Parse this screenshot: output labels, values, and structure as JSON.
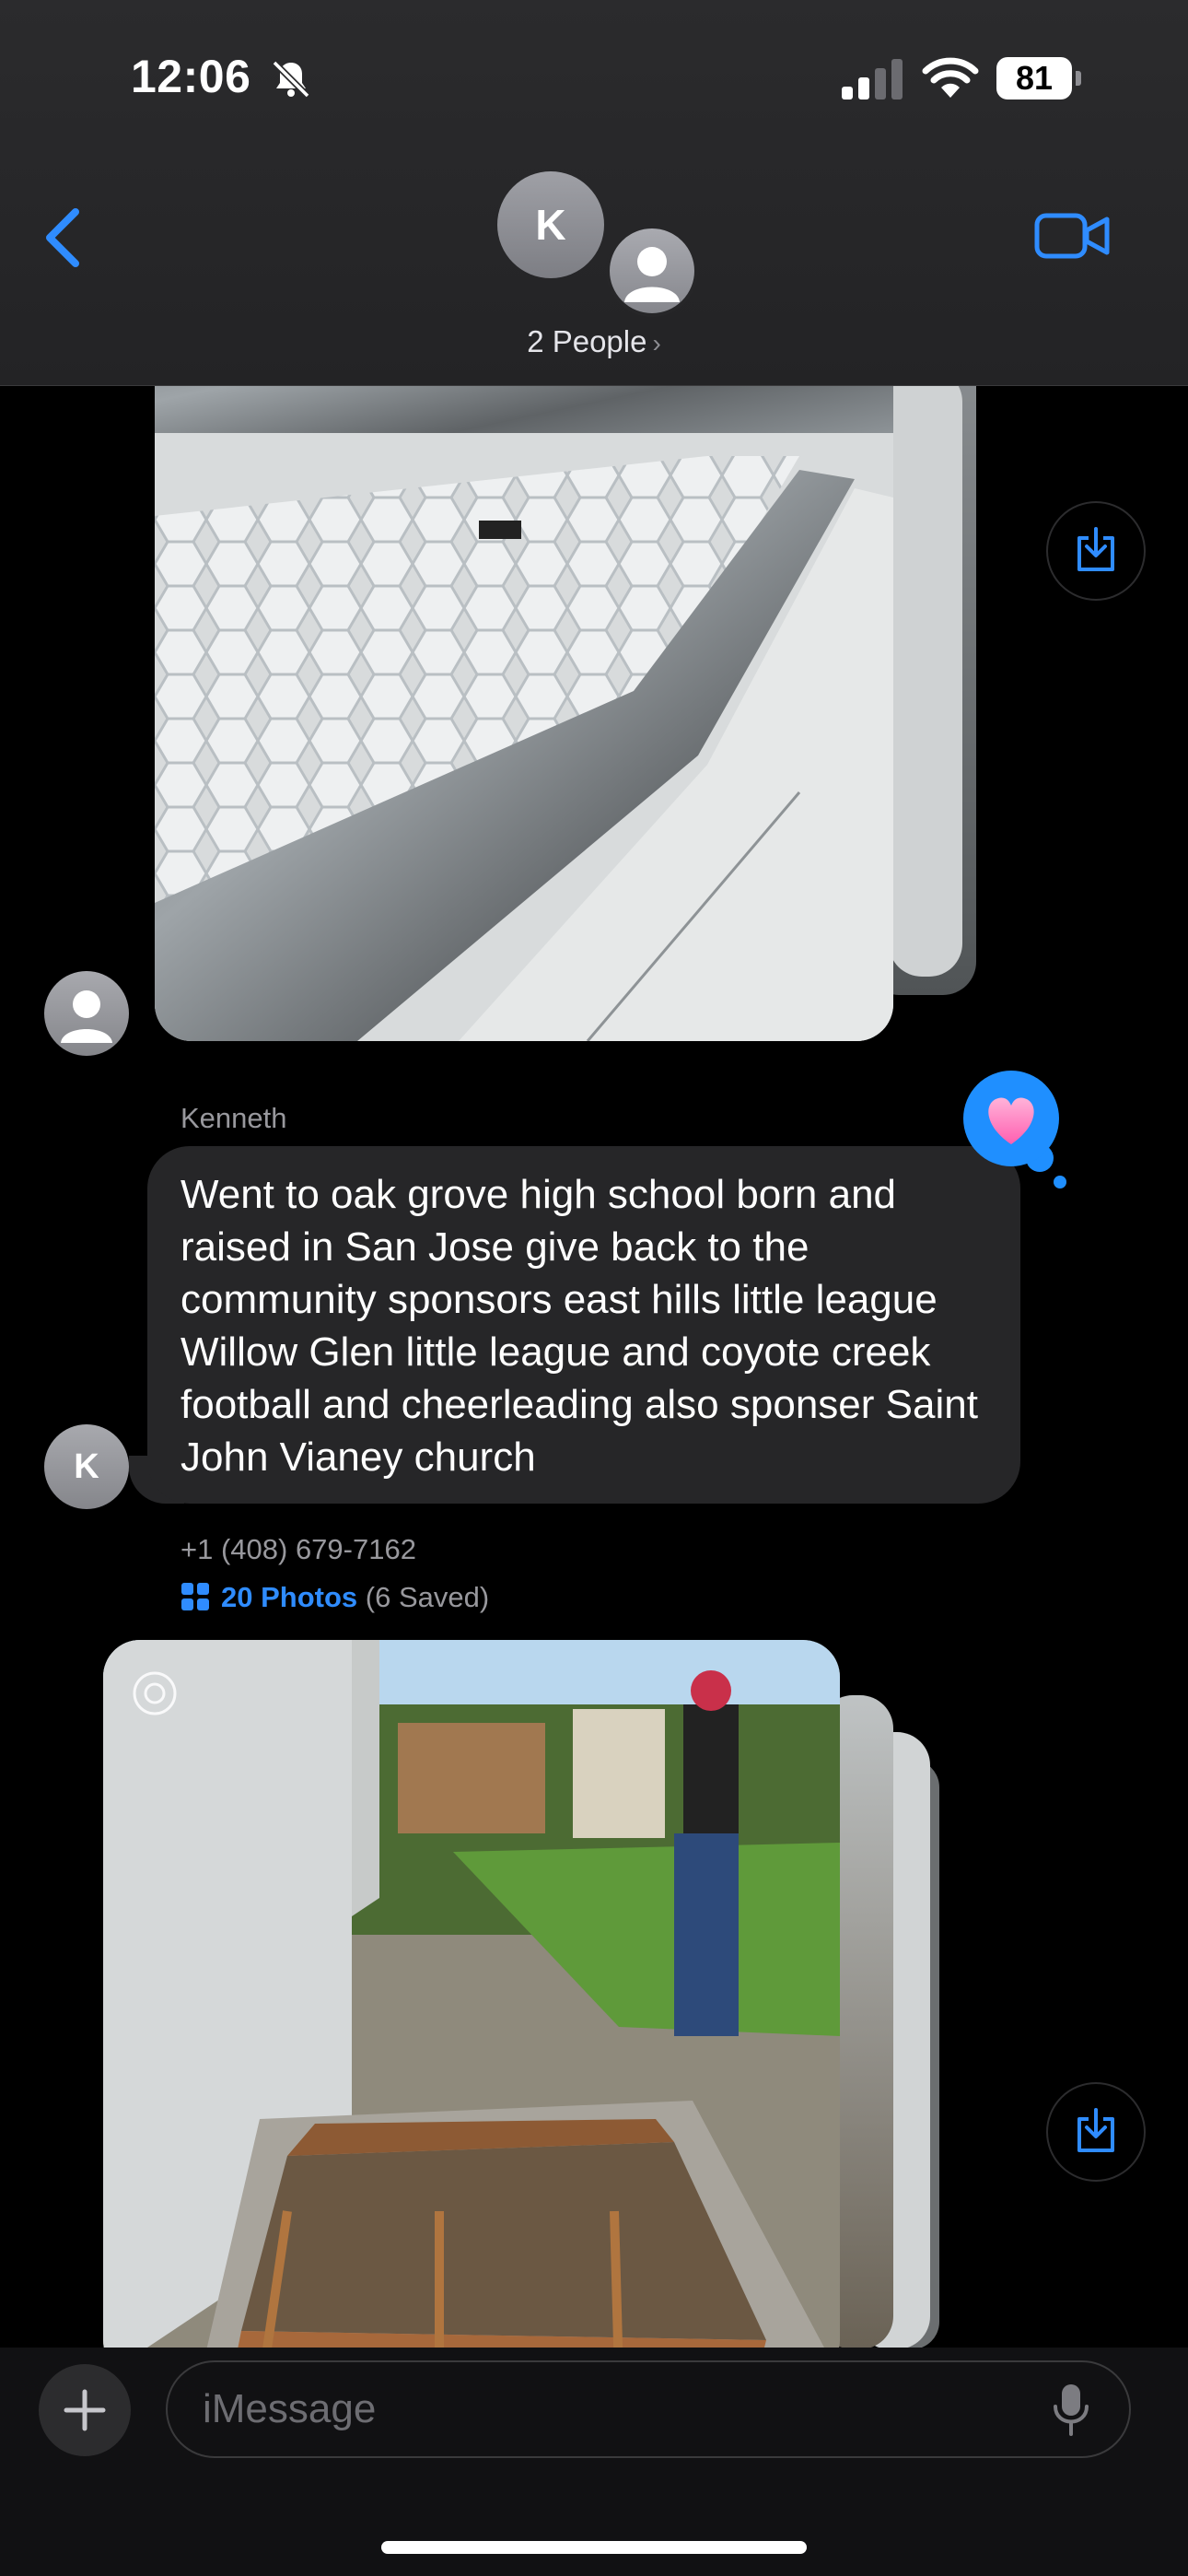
{
  "status_bar": {
    "time": "12:06",
    "battery": "81"
  },
  "conversation": {
    "avatar_initial": "K",
    "participants_label": "2 People",
    "participants_chevron": "›"
  },
  "messages": {
    "incoming_text": {
      "sender": "Kenneth",
      "avatar_initial": "K",
      "text": "Went to oak grove high school born and raised in San Jose give back to the community sponsors east hills little league Willow Glen little league and coyote creek football and cheerleading also sponser Saint John Vianey church",
      "reaction": "heart"
    },
    "photo_group": {
      "sender": "+1 (408) 679-7162",
      "photos_label": "20 Photos",
      "saved_label": "(6 Saved)"
    }
  },
  "composer": {
    "placeholder": "iMessage",
    "plus_label": "+"
  },
  "icons": {
    "back": "chevron-left-icon",
    "video": "video-camera-icon",
    "save": "save-to-photos-icon",
    "mic": "microphone-icon",
    "bell": "bell-slash-icon"
  },
  "colors": {
    "accent": "#2f8cff",
    "bubble": "#262628",
    "background": "#000000"
  }
}
